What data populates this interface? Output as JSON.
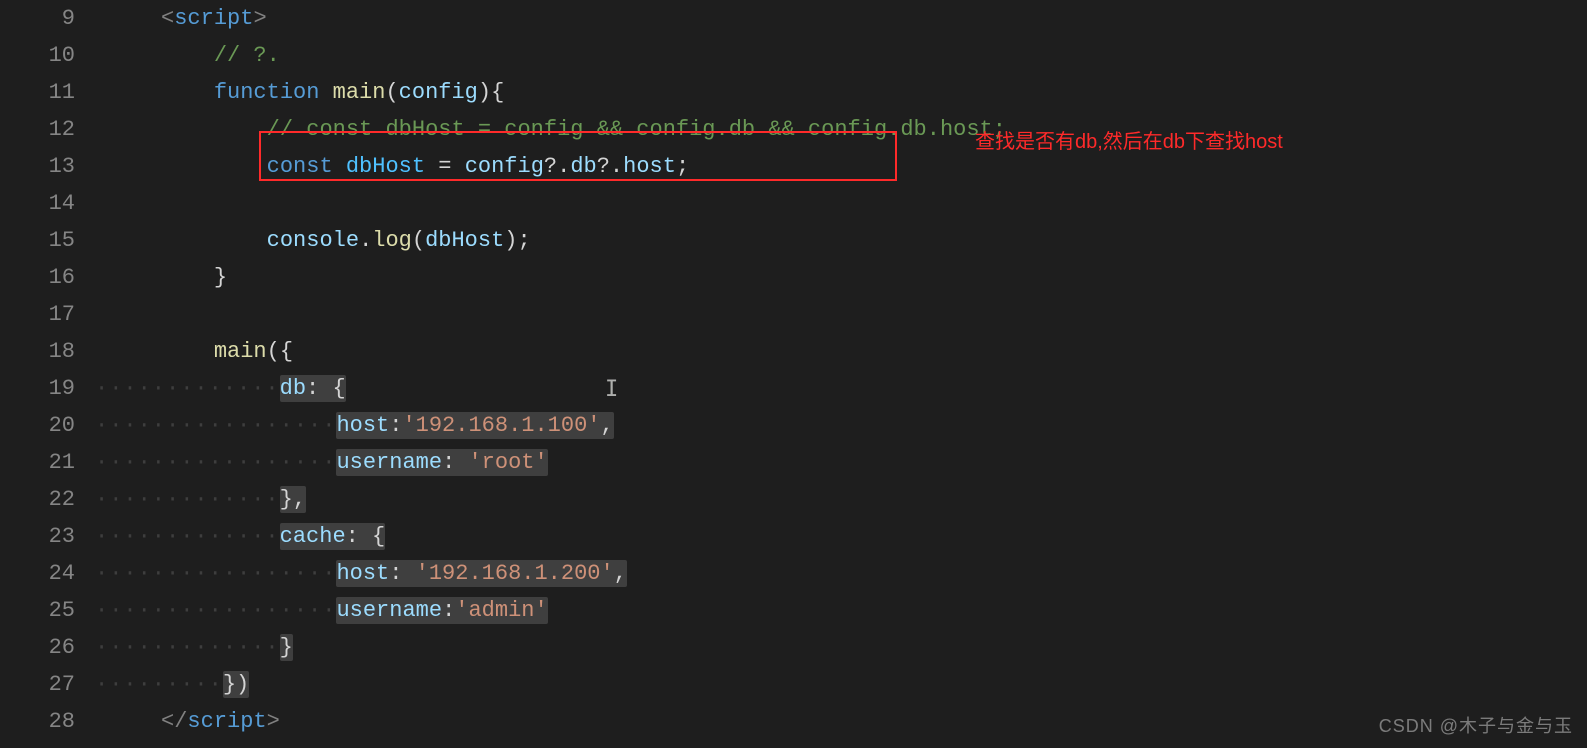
{
  "gutter": {
    "start": 9,
    "end": 28
  },
  "code": {
    "l9": {
      "open": "<",
      "tag": "script",
      "close": ">"
    },
    "l10": {
      "comment": "// ?."
    },
    "l11": {
      "kw": "function",
      "name": "main",
      "paren_open": "(",
      "param": "config",
      "paren_close": ")",
      "brace": "{"
    },
    "l12": {
      "comment": "// const dbHost = config && config.db && config.db.host;"
    },
    "l13": {
      "kw": "const",
      "var": "dbHost",
      "eq": " = ",
      "a": "config",
      "q1": "?.",
      "b": "db",
      "q2": "?.",
      "c": "host",
      "end": ";"
    },
    "l15": {
      "obj": "console",
      "dot": ".",
      "fn": "log",
      "open": "(",
      "arg": "dbHost",
      "close": ");"
    },
    "l16": {
      "brace": "}"
    },
    "l18": {
      "fn": "main",
      "open": "({"
    },
    "l19": {
      "key": "db",
      "sep": ": {"
    },
    "l20": {
      "key": "host",
      "sep": ":",
      "val": "'192.168.1.100'",
      "end": ","
    },
    "l21": {
      "key": "username",
      "sep": ": ",
      "val": "'root'"
    },
    "l22": {
      "close": "},"
    },
    "l23": {
      "key": "cache",
      "sep": ": {"
    },
    "l24": {
      "key": "host",
      "sep": ": ",
      "val": "'192.168.1.200'",
      "end": ","
    },
    "l25": {
      "key": "username",
      "sep": ":",
      "val": "'admin'"
    },
    "l26": {
      "close": "}"
    },
    "l27": {
      "close": "})"
    },
    "l28": {
      "open": "</",
      "tag": "script",
      "close": ">"
    }
  },
  "annotation": {
    "text": "查找是否有db,然后在db下查找host"
  },
  "watermark": {
    "text": "CSDN @木子与金与玉"
  },
  "colors": {
    "highlight": "#ff2a2a"
  }
}
